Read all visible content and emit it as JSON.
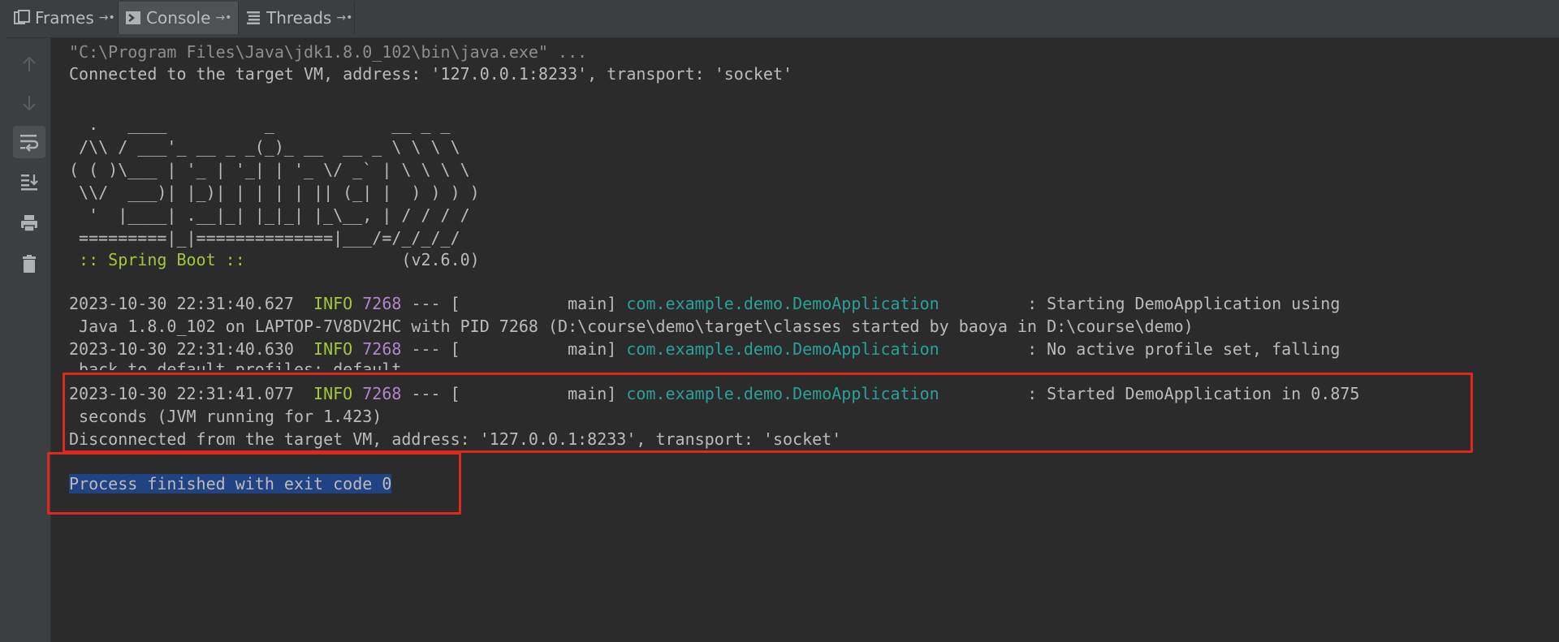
{
  "tabs": [
    {
      "label": "Frames",
      "icon": "frames-icon",
      "pin": "→•"
    },
    {
      "label": "Console",
      "icon": "console-icon",
      "pin": "→•"
    },
    {
      "label": "Threads",
      "icon": "threads-icon",
      "pin": "→•"
    }
  ],
  "toolbar": [
    "up-arrow-icon",
    "down-arrow-icon",
    "soft-wrap-icon",
    "scroll-to-end-icon",
    "print-icon",
    "trash-icon"
  ],
  "console": {
    "command": "\"C:\\Program Files\\Java\\jdk1.8.0_102\\bin\\java.exe\" ...",
    "connected": "Connected to the target VM, address: '127.0.0.1:8233', transport: 'socket'",
    "banner": [
      "  .   ____          _            __ _ _",
      " /\\\\ / ___'_ __ _ _(_)_ __  __ _ \\ \\ \\ \\",
      "( ( )\\___ | '_ | '_| | '_ \\/ _` | \\ \\ \\ \\",
      " \\\\/  ___)| |_)| | | | | || (_| |  ) ) ) )",
      "  '  |____| .__|_| |_|_| |_\\__, | / / / /",
      " =========|_|==============|___/=/_/_/_/"
    ],
    "boot_label": " :: Spring Boot :: ",
    "boot_version": "               (v2.6.0)",
    "logs": [
      {
        "time": "2023-10-30 22:31:40.627",
        "level": "INFO",
        "pid": "7268",
        "sep": " --- [           main] ",
        "logger": "com.example.demo.DemoApplication",
        "msg": "         : Starting DemoApplication using",
        "cont": " Java 1.8.0_102 on LAPTOP-7V8DV2HC with PID 7268 (D:\\course\\demo\\target\\classes started by baoya in D:\\course\\demo)"
      },
      {
        "time": "2023-10-30 22:31:40.630",
        "level": "INFO",
        "pid": "7268",
        "sep": " --- [           main] ",
        "logger": "com.example.demo.DemoApplication",
        "msg": "         : No active profile set, falling",
        "cont": " back to default profiles: default"
      },
      {
        "time": "2023-10-30 22:31:41.077",
        "level": "INFO",
        "pid": "7268",
        "sep": " --- [           main] ",
        "logger": "com.example.demo.DemoApplication",
        "msg": "         : Started DemoApplication in 0.875",
        "cont": " seconds (JVM running for 1.423)"
      }
    ],
    "disconnected": "Disconnected from the target VM, address: '127.0.0.1:8233', transport: 'socket'",
    "exit": "Process finished with exit code 0"
  },
  "colors": {
    "background": "#2b2b2b",
    "info": "#a4c639",
    "pid": "#b085ce",
    "logger": "#2aa198",
    "highlight_box": "#e0281e",
    "selection": "#214283"
  }
}
